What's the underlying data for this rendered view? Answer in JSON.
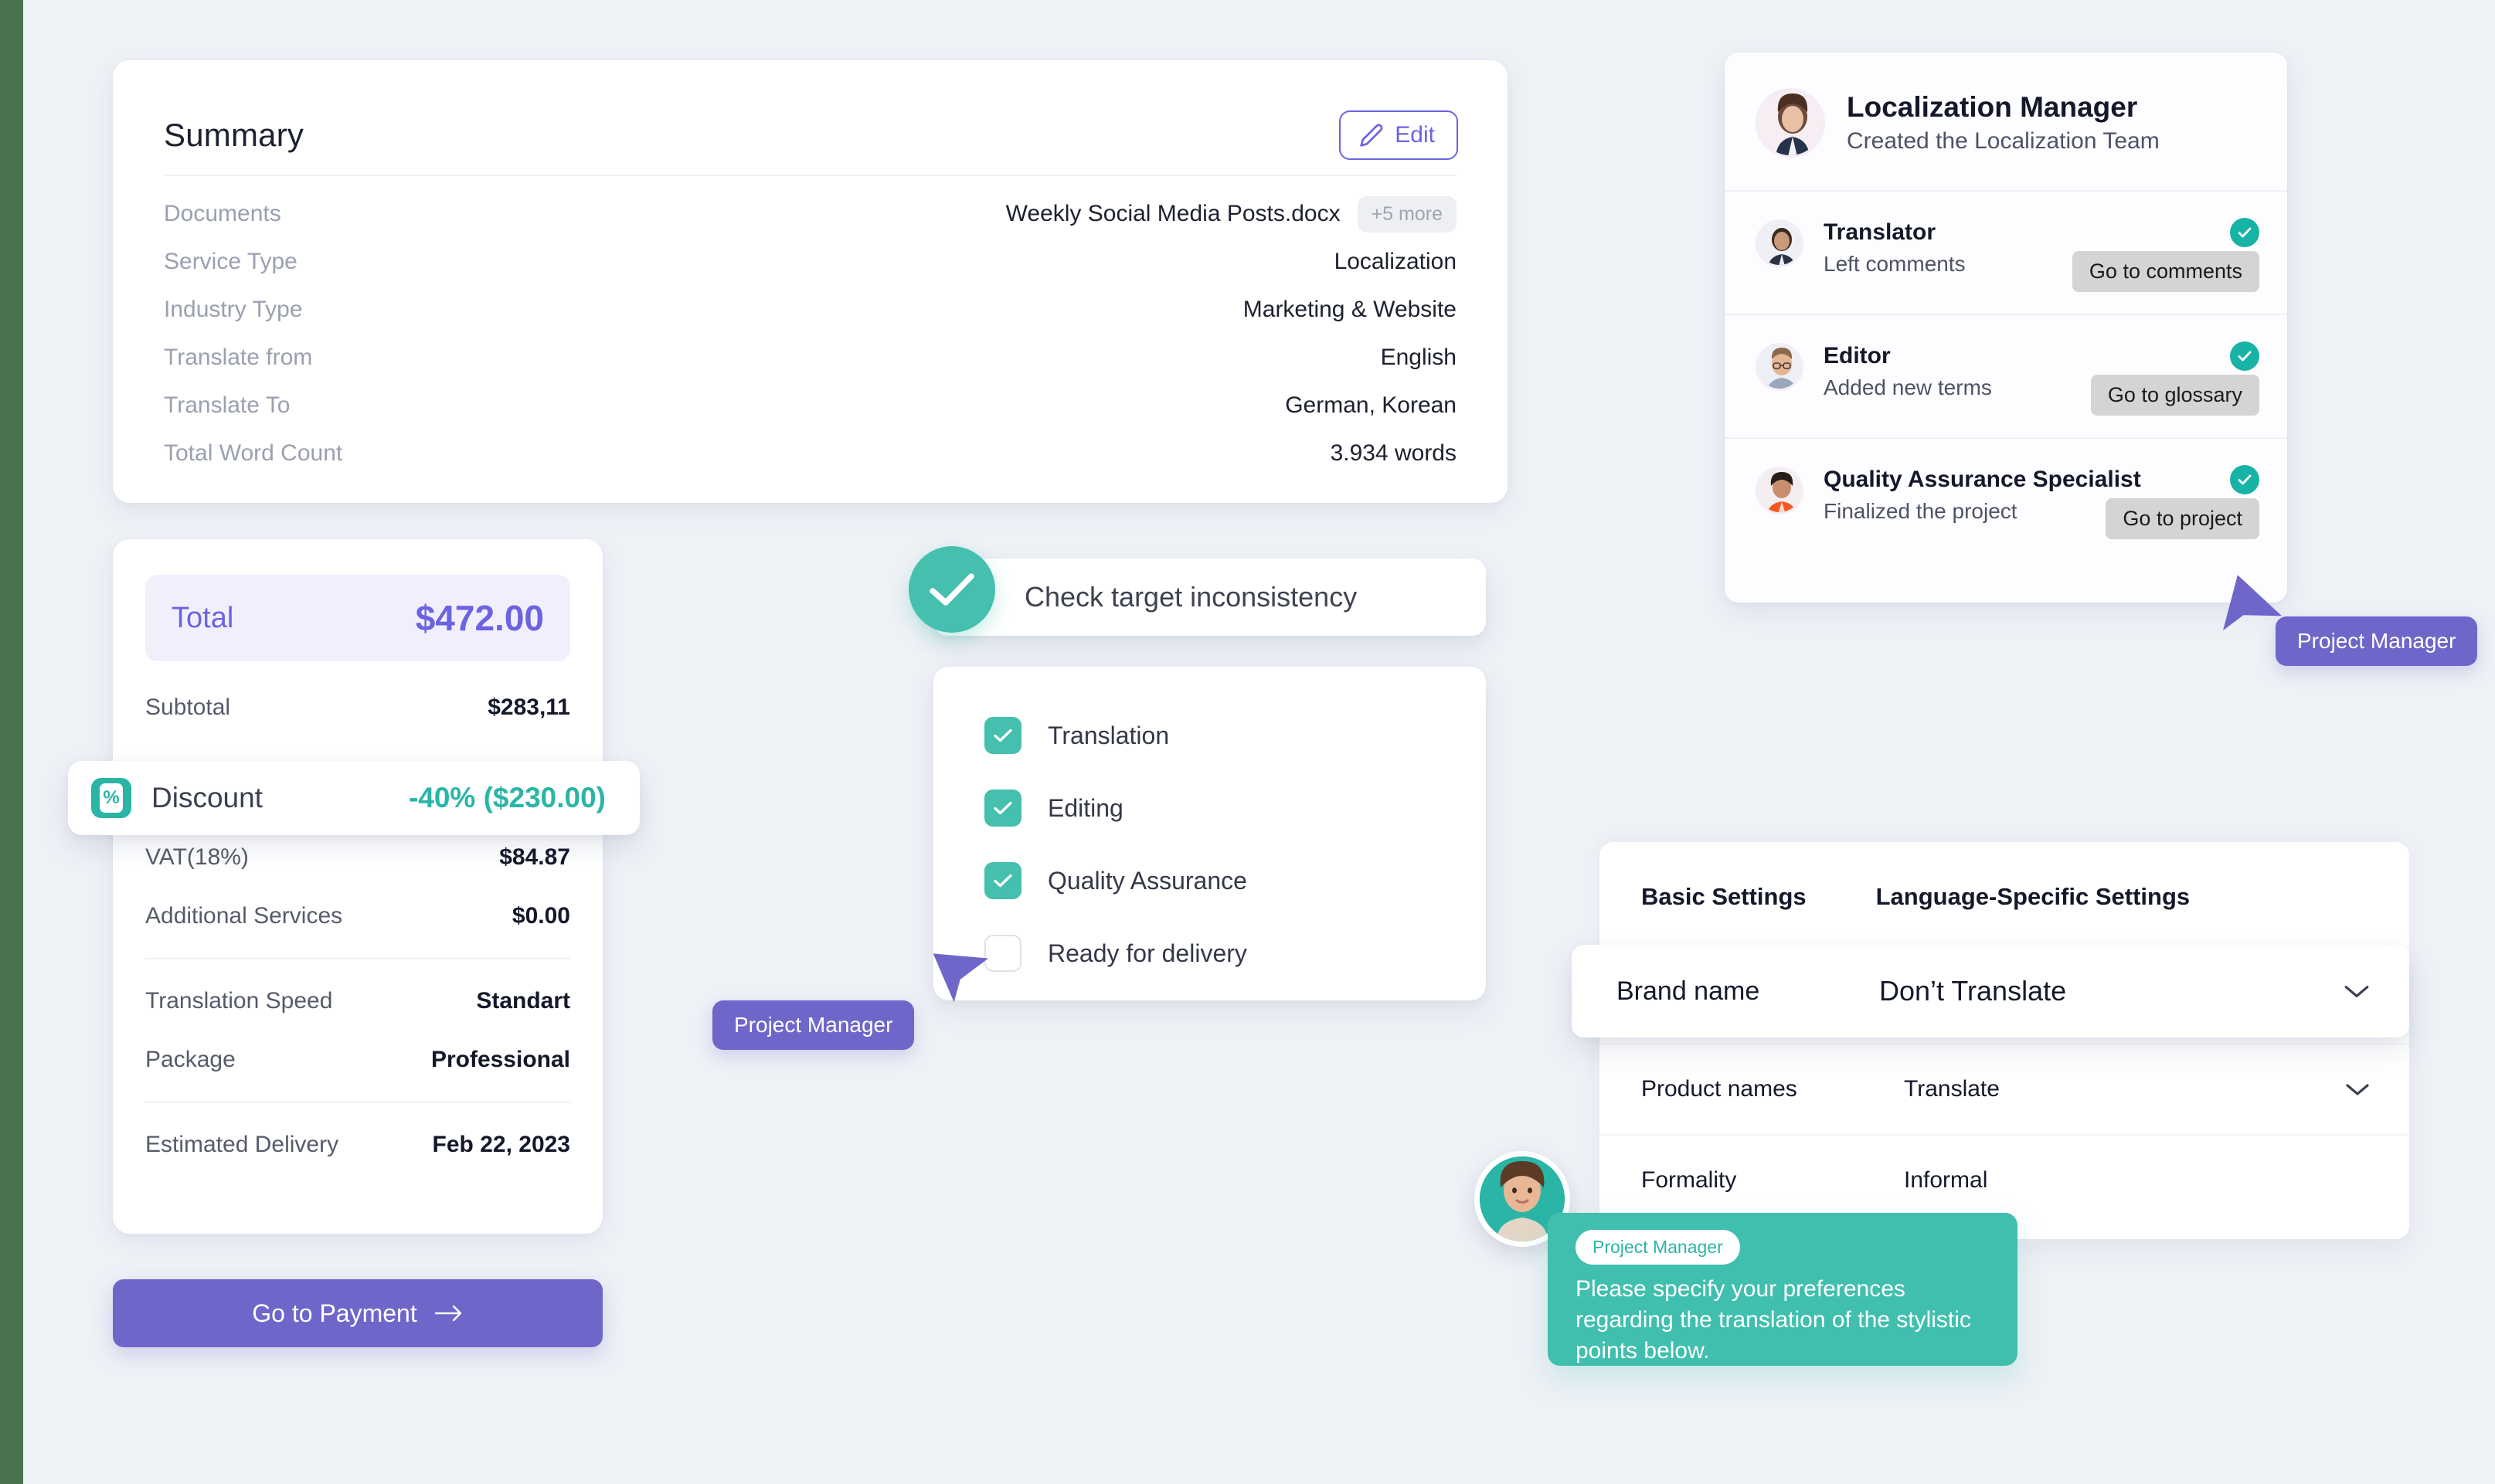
{
  "summary": {
    "title": "Summary",
    "edit_label": "Edit",
    "edit_icon": "pencil-icon",
    "rows": [
      {
        "label": "Documents",
        "value": "Weekly Social Media Posts.docx",
        "chip": "+5 more"
      },
      {
        "label": "Service Type",
        "value": "Localization"
      },
      {
        "label": "Industry Type",
        "value": "Marketing & Website"
      },
      {
        "label": "Translate from",
        "value": "English"
      },
      {
        "label": "Translate To",
        "value": "German, Korean"
      },
      {
        "label": "Total Word Count",
        "value": "3.934 words"
      }
    ]
  },
  "pricing": {
    "total_label": "Total",
    "total_value": "$472.00",
    "subtotal_label": "Subtotal",
    "subtotal_value": "$283,11",
    "discount": {
      "icon": "percent-icon",
      "glyph": "%",
      "label": "Discount",
      "value": "-40% ($230.00)"
    },
    "rows_mid": [
      {
        "label": "VAT(18%)",
        "value": "$84.87"
      },
      {
        "label": "Additional Services",
        "value": "$0.00"
      }
    ],
    "rows_opts": [
      {
        "label": "Translation Speed",
        "value": "Standart"
      },
      {
        "label": "Package",
        "value": "Professional"
      }
    ],
    "rows_delivery": [
      {
        "label": "Estimated Delivery",
        "value": "Feb 22, 2023"
      }
    ],
    "pay_button": "Go to Payment",
    "pay_icon": "arrow-right-icon"
  },
  "check_banner": {
    "icon": "check-circle-icon",
    "label": "Check target inconsistency"
  },
  "checklist": {
    "items": [
      {
        "label": "Translation",
        "checked": true
      },
      {
        "label": "Editing",
        "checked": true
      },
      {
        "label": "Quality Assurance",
        "checked": true
      },
      {
        "label": "Ready for delivery",
        "checked": false
      }
    ]
  },
  "cursors": {
    "checklist_badge": "Project Manager",
    "team_badge": "Project Manager"
  },
  "team": {
    "header": {
      "name": "Localization Manager",
      "subtitle": "Created the Localization Team",
      "avatar": "avatar-localization-manager"
    },
    "members": [
      {
        "role": "Translator",
        "activity": "Left comments",
        "action": "Go to comments",
        "status": "done",
        "avatar": "avatar-translator"
      },
      {
        "role": "Editor",
        "activity": "Added new terms",
        "action": "Go to glossary",
        "status": "done",
        "avatar": "avatar-editor"
      },
      {
        "role": "Quality Assurance Specialist",
        "activity": "Finalized the project",
        "action": "Go to project",
        "status": "done",
        "avatar": "avatar-qa-specialist"
      }
    ]
  },
  "settings": {
    "tabs": [
      {
        "label": "Basic Settings",
        "active": true
      },
      {
        "label": "Language-Specific Settings",
        "active": false
      }
    ],
    "highlighted_row": {
      "label": "Brand name",
      "value": "Don’t Translate",
      "icon": "chevron-down-icon"
    },
    "rows": [
      {
        "label": "Product names",
        "value": "Translate",
        "icon": "chevron-down-icon"
      },
      {
        "label": "Formality",
        "value": "Informal",
        "icon": ""
      }
    ]
  },
  "chat": {
    "tag": "Project Manager",
    "message": "Please specify your preferences regarding the translation of the stylistic points below.",
    "avatar": "avatar-project-manager"
  },
  "colors": {
    "accent_purple": "#6c63e0",
    "accent_teal": "#2ab5a6",
    "page_bg": "#eef1f6",
    "edge_strip": "#4a7350"
  }
}
